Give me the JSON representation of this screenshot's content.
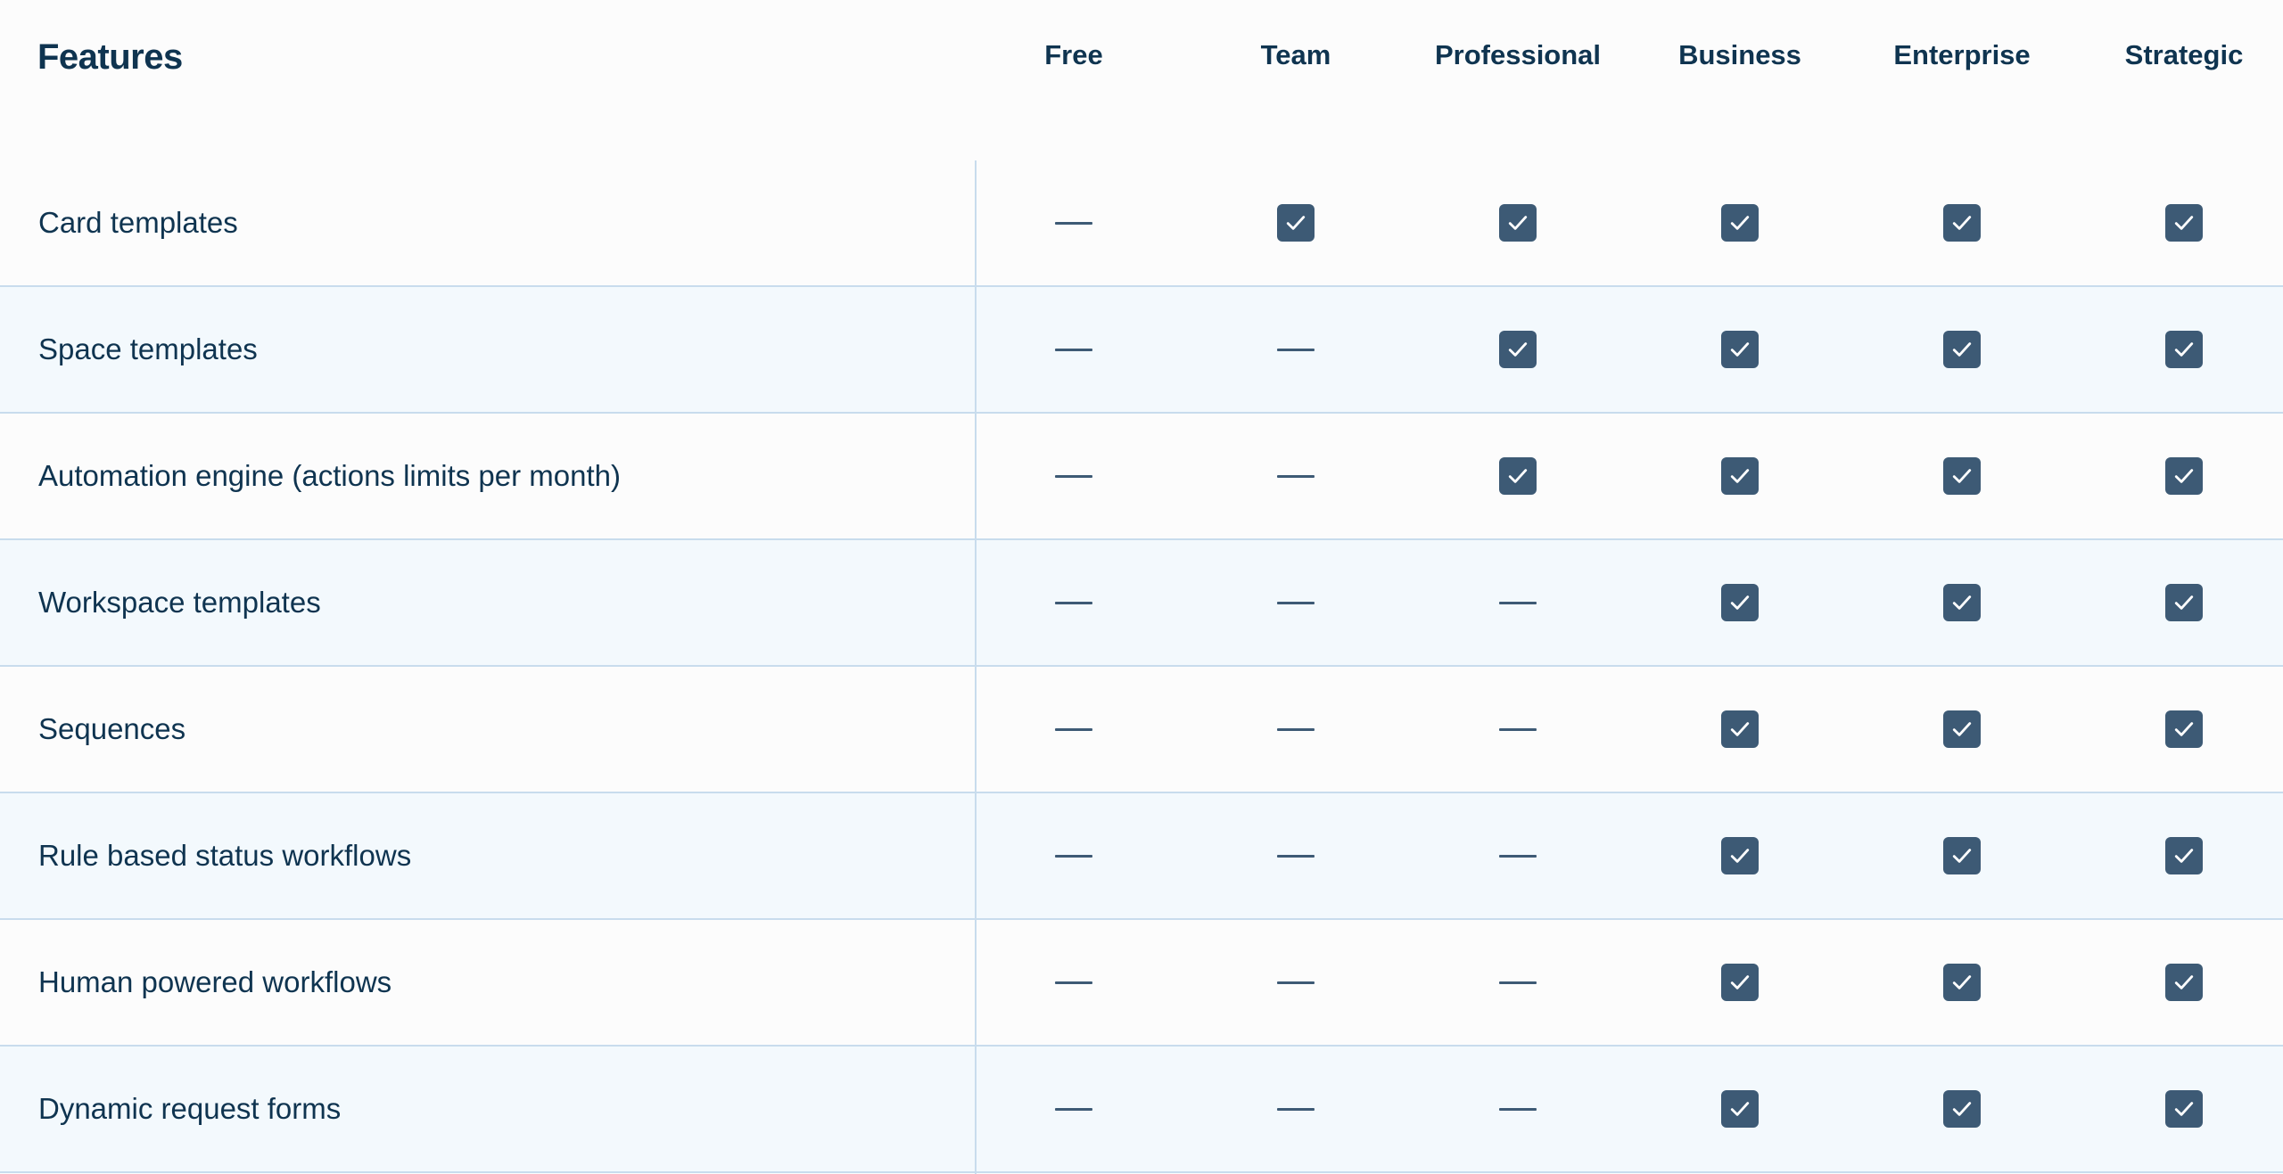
{
  "header": {
    "features_title": "Features",
    "plans": [
      "Free",
      "Team",
      "Professional",
      "Business",
      "Enterprise",
      "Strategic"
    ]
  },
  "rows": [
    {
      "label": "Card templates",
      "values": [
        false,
        true,
        true,
        true,
        true,
        true
      ]
    },
    {
      "label": "Space templates",
      "values": [
        false,
        false,
        true,
        true,
        true,
        true
      ]
    },
    {
      "label": "Automation engine (actions limits per month)",
      "values": [
        false,
        false,
        true,
        true,
        true,
        true
      ]
    },
    {
      "label": "Workspace templates",
      "values": [
        false,
        false,
        false,
        true,
        true,
        true
      ]
    },
    {
      "label": "Sequences",
      "values": [
        false,
        false,
        false,
        true,
        true,
        true
      ]
    },
    {
      "label": "Rule based status workflows",
      "values": [
        false,
        false,
        false,
        true,
        true,
        true
      ]
    },
    {
      "label": "Human powered workflows",
      "values": [
        false,
        false,
        false,
        true,
        true,
        true
      ]
    },
    {
      "label": "Dynamic request forms",
      "values": [
        false,
        false,
        false,
        true,
        true,
        true
      ]
    }
  ],
  "icons": {
    "included": "checkbox-checked-icon",
    "not_included": "dash-icon"
  },
  "colors": {
    "text": "#0f3450",
    "icon": "#3d5a75",
    "alt_row": "#f3f9fd",
    "divider": "#c8dced"
  }
}
